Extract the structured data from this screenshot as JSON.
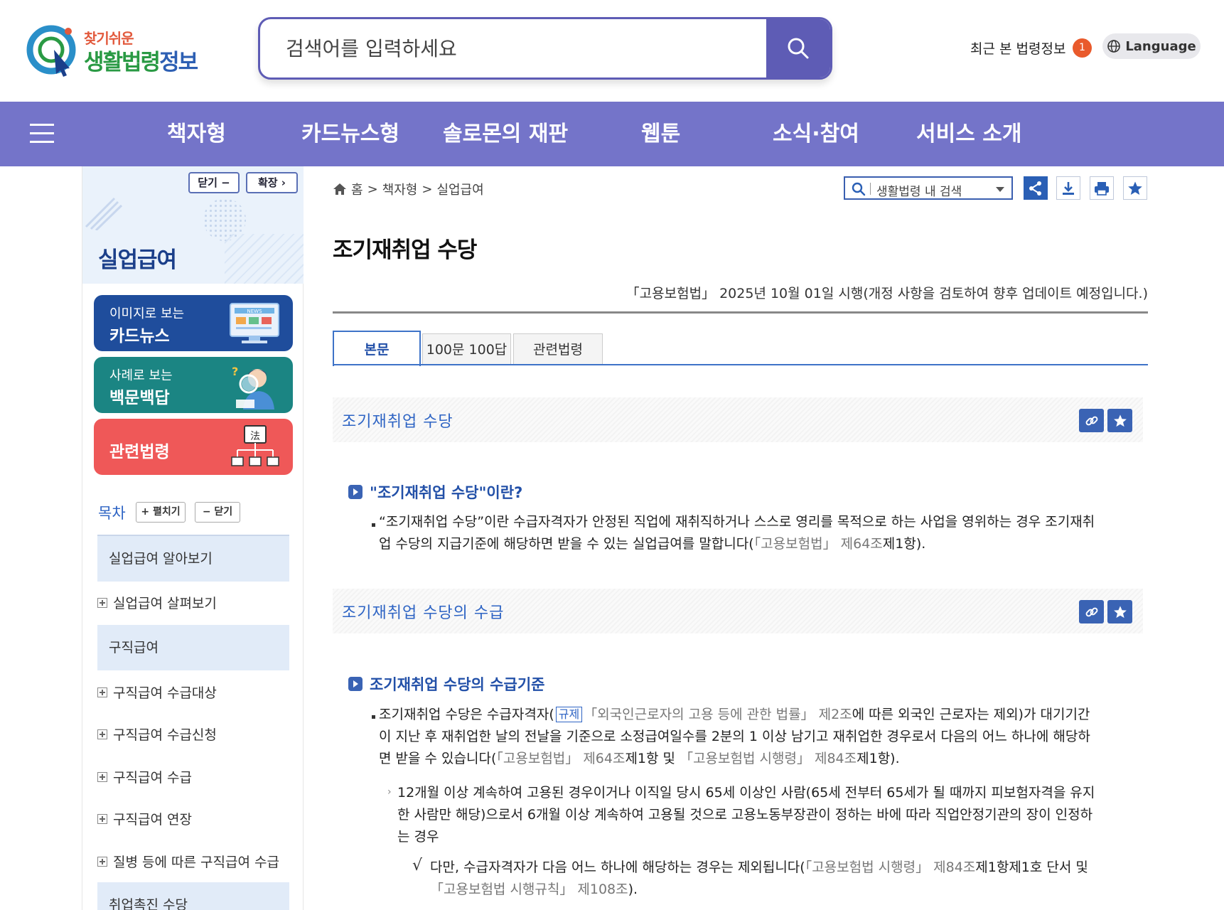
{
  "header": {
    "logo_sub": "찾기쉬운",
    "logo_main_part1": "생활법령",
    "logo_main_part2": "정보",
    "search_placeholder": "검색어를 입력하세요",
    "recent_label": "최근 본 법령정보",
    "recent_count": "1",
    "language_label": "Language"
  },
  "nav": {
    "items": [
      "책자형",
      "카드뉴스형",
      "솔로몬의 재판",
      "웹툰",
      "소식·참여",
      "서비스 소개"
    ]
  },
  "sidebar": {
    "collapse_label": "닫기 −",
    "expand_label": "확장 ›",
    "title": "실업급여",
    "cards": [
      {
        "small": "이미지로 보는",
        "big": "카드뉴스",
        "color": "#1f4d9c"
      },
      {
        "small": "사례로 보는",
        "big": "백문백답",
        "color": "#1b8583"
      },
      {
        "big": "관련법령",
        "color": "#ef5858"
      }
    ],
    "card_icon_text": "法",
    "card_news_text": "NEWS",
    "toc_label": "목차",
    "toc_expand": "+ 펼치기",
    "toc_collapse": "− 닫기",
    "toc": {
      "sec1": "실업급여 알아보기",
      "item1": "실업급여 살펴보기",
      "sec2": "구직급여",
      "item2": "구직급여 수급대상",
      "item3": "구직급여 수급신청",
      "item4": "구직급여 수급",
      "item5": "구직급여 연장",
      "item6": "질병 등에 따른 구직급여 수급",
      "sec3": "취업촉진 수당"
    }
  },
  "main": {
    "breadcrumb": {
      "home": "홈",
      "sep": ">",
      "level1": "책자형",
      "level2": "실업급여"
    },
    "law_search_label": "생활법령 내 검색",
    "page_title": "조기재취업 수당",
    "law_info": "「고용보험법」 2025년 10월 01일 시행(개정 사항을 검토하여 향후 업데이트 예정입니다.)",
    "tabs": [
      "본문",
      "100문 100답",
      "관련법령"
    ],
    "section1_title": "조기재취업 수당",
    "q1_title": "\"조기재취업 수당\"이란?",
    "q1_body_a": "“조기재취업 수당”이란 수급자격자가 안정된 직업에 재취직하거나 스스로 영리를 목적으로 하는 사업을 영위하는 경우 조기재취",
    "q1_body_b": "업 수당의 지급기준에 해당하면 받을 수 있는 실업급여를 말합니다(",
    "q1_ref1": "「고용보험법」 제64조",
    "q1_ref1_tail": "제1항).",
    "section2_title": "조기재취업 수당의 수급",
    "q2_title": "조기재취업 수당의 수급기준",
    "q2_body_a1": "조기재취업 수당은 수급자격자(",
    "q2_tag": "규제",
    "q2_ref0": "「외국인근로자의 고용 등에 관한 법률」 제2조",
    "q2_body_a2": "에 따른 외국인 근로자는 제외)가 대기기간",
    "q2_body_b": "이 지난 후 재취업한 날의 전날을 기준으로 소정급여일수를 2분의 1 이상 남기고 재취업한 경우로서 다음의 어느 하나에 해당하",
    "q2_body_c1": "면 받을 수 있습니다(",
    "q2_ref1": "「고용보험법」 제64조",
    "q2_body_c2": "제1항 및 ",
    "q2_ref2": "「고용보험법 시행령」 제84조",
    "q2_body_c3": "제1항).",
    "q2_sub_a": "12개월 이상 계속하여 고용된 경우이거나 이직일 당시 65세 이상인 사람(65세 전부터 65세가 될 때까지 피보험자격을 유지",
    "q2_sub_b": "한 사람만 해당)으로서 6개월 이상 계속하여 고용될 것으로 고용노동부장관이 정하는 바에 따라 직업안정기관의 장이 인정하",
    "q2_sub_c": "는 경우",
    "q2_check_a1": "다만, 수급자격자가 다음 어느 하나에 해당하는 경우는 제외됩니다(",
    "q2_check_ref1": "「고용보험법 시행령」 제84조",
    "q2_check_a2": "제1항제1호 단서 및",
    "q2_check_ref2": "「고용보험법 시행규칙」 제108조",
    "q2_check_b2": ")."
  },
  "colors": {
    "brand_purple": "#7474c9",
    "search_border": "#5e5cb5",
    "link_blue": "#2e64c4",
    "badge_orange": "#e95a2c"
  }
}
